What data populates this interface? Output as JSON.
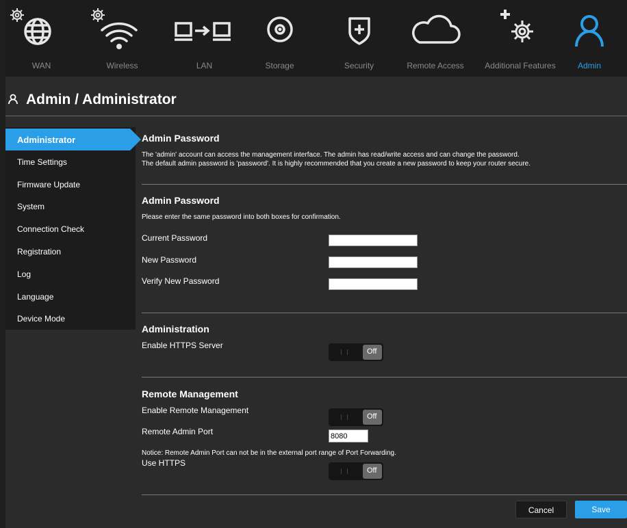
{
  "nav": {
    "items": [
      {
        "label": "WAN",
        "icon": "wan-globe-icon"
      },
      {
        "label": "Wireless",
        "icon": "wifi-icon"
      },
      {
        "label": "LAN",
        "icon": "lan-computers-icon"
      },
      {
        "label": "Storage",
        "icon": "disk-icon"
      },
      {
        "label": "Security",
        "icon": "shield-icon"
      },
      {
        "label": "Remote Access",
        "icon": "cloud-icon"
      },
      {
        "label": "Additional Features",
        "icon": "plus-gear-icon"
      },
      {
        "label": "Admin",
        "icon": "user-icon"
      }
    ],
    "active": "Admin"
  },
  "page": {
    "title": "Admin / Administrator"
  },
  "sidebar": {
    "items": [
      {
        "label": "Administrator"
      },
      {
        "label": "Time Settings"
      },
      {
        "label": "Firmware Update"
      },
      {
        "label": "System"
      },
      {
        "label": "Connection Check"
      },
      {
        "label": "Registration"
      },
      {
        "label": "Log"
      },
      {
        "label": "Language"
      },
      {
        "label": "Device Mode"
      }
    ],
    "active": "Administrator"
  },
  "intro": {
    "heading": "Admin Password",
    "line1": "The 'admin' account can access the management interface. The admin has read/write access and can change the password.",
    "line2": "The default admin password is 'password'. It is highly recommended that you create a new password to keep your router secure."
  },
  "password": {
    "heading": "Admin Password",
    "note": "Please enter the same password into both boxes for confirmation.",
    "current_label": "Current Password",
    "current_value": "",
    "new_label": "New Password",
    "new_value": "",
    "verify_label": "Verify New Password",
    "verify_value": ""
  },
  "administration": {
    "heading": "Administration",
    "https_label": "Enable HTTPS Server",
    "https_state": "Off"
  },
  "remote": {
    "heading": "Remote Management",
    "enable_label": "Enable Remote Management",
    "enable_state": "Off",
    "port_label": "Remote Admin Port",
    "port_value": "8080",
    "notice": "Notice: Remote Admin Port can not be in the external port range of Port Forwarding.",
    "https_label": "Use HTTPS",
    "https_state": "Off"
  },
  "actions": {
    "cancel": "Cancel",
    "save": "Save"
  },
  "colors": {
    "accent": "#2a9fe8",
    "background": "#2b2b2b",
    "panel": "#1c1c1c"
  }
}
